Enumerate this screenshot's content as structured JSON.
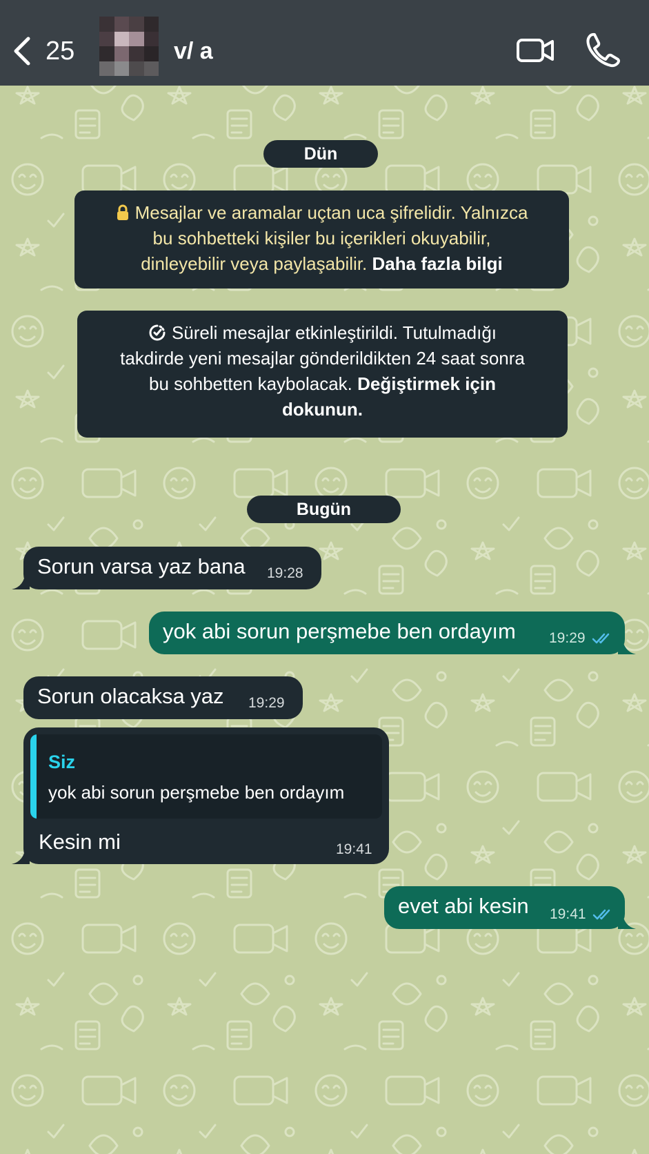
{
  "header": {
    "back_count": "25",
    "contact_name": "v/ a",
    "video_icon": "video-camera-icon",
    "call_icon": "phone-icon"
  },
  "colors": {
    "header_bg": "#3a4147",
    "wallpaper": "#c3cf9f",
    "incoming_bubble": "#1f2a31",
    "outgoing_bubble": "#0e6b57",
    "system_text": "#f3e6a8",
    "read_ticks": "#53bdeb",
    "quote_accent": "#2ad3ec"
  },
  "dates": {
    "yesterday": "Dün",
    "today": "Bugün"
  },
  "system": {
    "encryption_line1": "Mesajlar ve aramalar uçtan uca şifrelidir. Yalnızca",
    "encryption_line2": "bu sohbetteki kişiler bu içerikleri okuyabilir,",
    "encryption_line3": "dinleyebilir veya paylaşabilir.",
    "encryption_link": "Daha fazla bilgi",
    "disappearing_line1": "Süreli mesajlar etkinleştirildi. Tutulmadığı",
    "disappearing_line2": "takdirde yeni mesajlar gönderildikten 24 saat sonra",
    "disappearing_line3": "bu sohbetten kaybolacak.",
    "disappearing_action_line1": "Değiştirmek için",
    "disappearing_action_line2": "dokunun."
  },
  "messages": [
    {
      "direction": "incoming",
      "text": "Sorun varsa yaz bana",
      "time": "19:28"
    },
    {
      "direction": "outgoing",
      "text": "yok abi sorun perşmebe ben ordayım",
      "time": "19:29",
      "status": "read"
    },
    {
      "direction": "incoming",
      "text": "Sorun olacaksa yaz",
      "time": "19:29"
    },
    {
      "direction": "incoming",
      "text": "Kesin mi",
      "time": "19:41",
      "quote": {
        "author": "Siz",
        "text": "yok abi sorun perşmebe ben ordayım"
      }
    },
    {
      "direction": "outgoing",
      "text": "evet abi kesin",
      "time": "19:41",
      "status": "read"
    }
  ]
}
